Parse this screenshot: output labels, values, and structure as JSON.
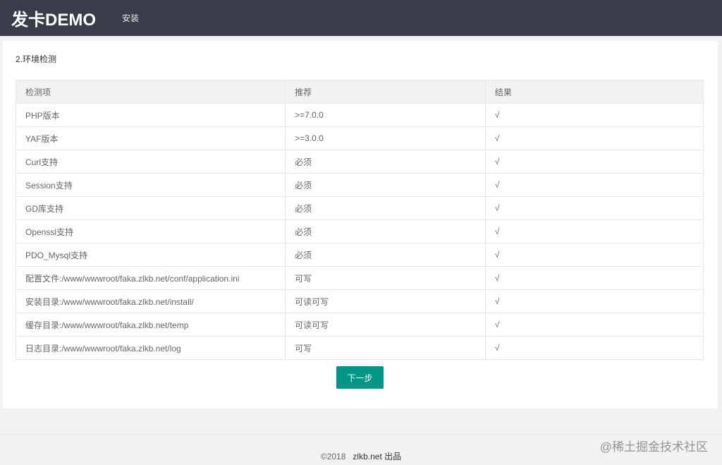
{
  "header": {
    "brand": "发卡DEMO",
    "nav_install": "安装"
  },
  "section": {
    "title": "2.环境检测"
  },
  "table": {
    "headers": [
      "检测项",
      "推荐",
      "结果"
    ],
    "rows": [
      {
        "item": "PHP版本",
        "recommend": ">=7.0.0",
        "result": "√"
      },
      {
        "item": "YAF版本",
        "recommend": ">=3.0.0",
        "result": "√"
      },
      {
        "item": "Curl支持",
        "recommend": "必须",
        "result": "√"
      },
      {
        "item": "Session支持",
        "recommend": "必须",
        "result": "√"
      },
      {
        "item": "GD库支持",
        "recommend": "必须",
        "result": "√"
      },
      {
        "item": "Openssl支持",
        "recommend": "必须",
        "result": "√"
      },
      {
        "item": "PDO_Mysql支持",
        "recommend": "必须",
        "result": "√"
      },
      {
        "item": "配置文件:/www/wwwroot/faka.zlkb.net/conf/application.ini",
        "recommend": "可写",
        "result": "√"
      },
      {
        "item": "安装目录:/www/wwwroot/faka.zlkb.net/install/",
        "recommend": "可读可写",
        "result": "√"
      },
      {
        "item": "缓存目录:/www/wwwroot/faka.zlkb.net/temp",
        "recommend": "可读可写",
        "result": "√"
      },
      {
        "item": "日志目录:/www/wwwroot/faka.zlkb.net/log",
        "recommend": "可写",
        "result": "√"
      }
    ]
  },
  "actions": {
    "next_label": "下一步"
  },
  "footer": {
    "copyright": "©2018",
    "owner": "zlkb.net 出品"
  },
  "watermark": {
    "text": "@稀土掘金技术社区"
  },
  "colors": {
    "topbar": "#393d49",
    "primary_button": "#009688",
    "page_background": "#f2f2f2"
  }
}
